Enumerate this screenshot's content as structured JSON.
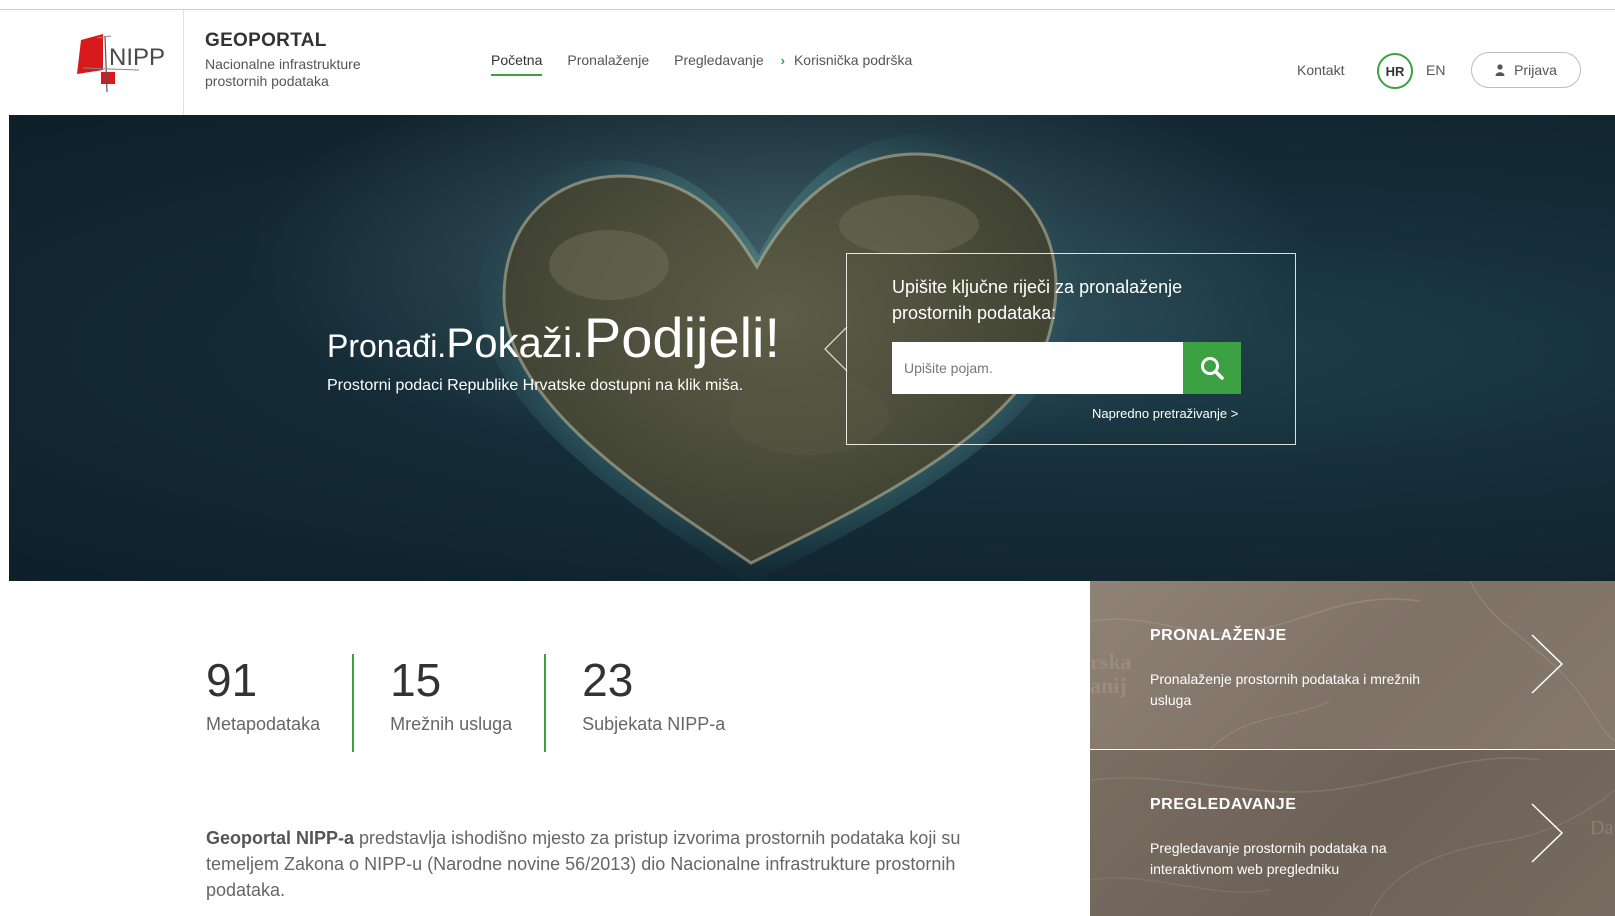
{
  "header": {
    "logo_text": "NIPP",
    "brand_title": "GEOPORTAL",
    "brand_subtitle": "Nacionalne infrastrukture prostornih podataka",
    "nav": [
      {
        "label": "Početna",
        "active": true
      },
      {
        "label": "Pronalaženje"
      },
      {
        "label": "Pregledavanje"
      },
      {
        "label": "Korisnička podrška",
        "icon": "chevron-right-icon"
      }
    ],
    "kontakt": "Kontakt",
    "lang_hr": "HR",
    "lang_en": "EN",
    "login": "Prijava",
    "accent_color": "#3ca142"
  },
  "hero": {
    "tagline_1": "Pronađi.",
    "tagline_2": "Pokaži.",
    "tagline_3": "Podijeli!",
    "subtitle": "Prostorni podaci Republike Hrvatske dostupni na klik miša.",
    "search_label": "Upišite ključne riječi za pronalaženje prostornih podataka:",
    "search_placeholder": "Upišite pojam.",
    "search_icon": "search-icon",
    "advanced_link": "Napredno pretraživanje >"
  },
  "stats": [
    {
      "value": "91",
      "label": "Metapodataka"
    },
    {
      "value": "15",
      "label": "Mrežnih usluga"
    },
    {
      "value": "23",
      "label": "Subjekata NIPP-a"
    }
  ],
  "intro": {
    "bold": "Geoportal NIPP-a",
    "text": " predstavlja ishodišno mjesto za pristup izvorima prostornih podataka koji su temeljem Zakona o NIPP-u (Narodne novine 56/2013) dio Nacionalne infrastrukture prostornih podataka."
  },
  "tiles": [
    {
      "title": "PRONALAŽENJE",
      "desc": "Pronalaženje prostornih podataka i mrežnih usluga",
      "bg_text": "rska\nanij"
    },
    {
      "title": "PREGLEDAVANJE",
      "desc": "Pregledavanje prostornih podataka na interaktivnom web pregledniku",
      "bg_text": "Da"
    }
  ]
}
